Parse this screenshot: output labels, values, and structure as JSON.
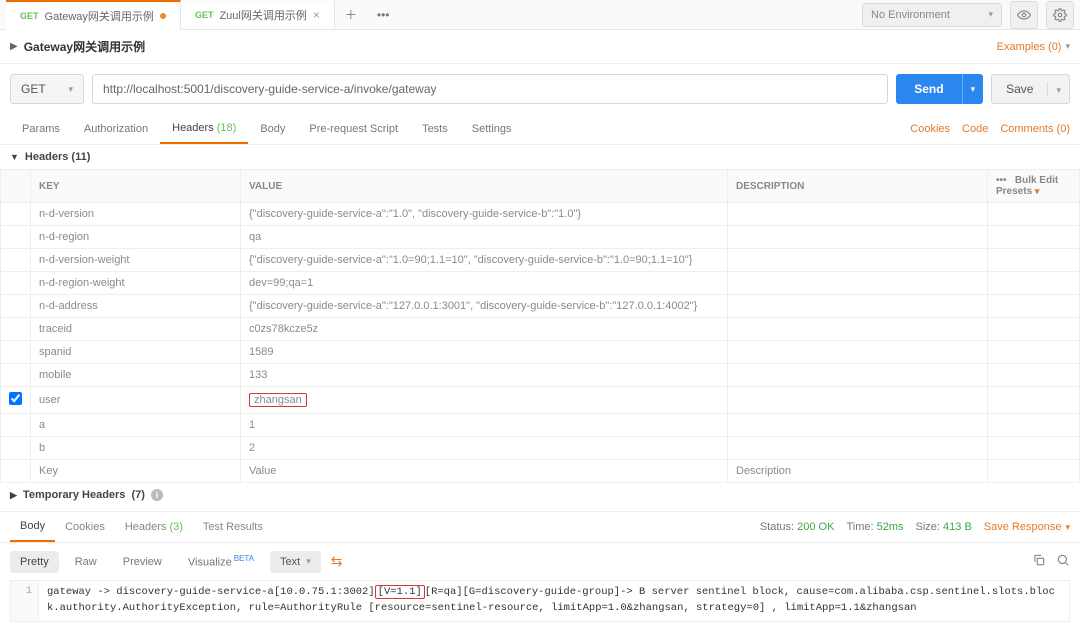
{
  "topbar": {
    "tabs": [
      {
        "method": "GET",
        "name": "Gateway网关调用示例",
        "dirty": true
      },
      {
        "method": "GET",
        "name": "Zuul网关调用示例",
        "dirty": false
      }
    ],
    "env_label": "No Environment"
  },
  "titlebar": {
    "title": "Gateway网关调用示例",
    "examples_label": "Examples (0)"
  },
  "request": {
    "method": "GET",
    "url": "http://localhost:5001/discovery-guide-service-a/invoke/gateway",
    "send_label": "Send",
    "save_label": "Save"
  },
  "req_tabs": {
    "items": [
      {
        "label": "Params"
      },
      {
        "label": "Authorization"
      },
      {
        "label": "Headers",
        "count": "(18)"
      },
      {
        "label": "Body"
      },
      {
        "label": "Pre-request Script"
      },
      {
        "label": "Tests"
      },
      {
        "label": "Settings"
      }
    ],
    "active_index": 2,
    "right": {
      "cookies": "Cookies",
      "code": "Code",
      "comments": "Comments (0)"
    }
  },
  "headers_section": {
    "title": "Headers",
    "count": "(11)",
    "columns": {
      "key": "KEY",
      "value": "VALUE",
      "description": "DESCRIPTION",
      "bulk": "Bulk Edit",
      "presets": "Presets"
    },
    "rows": [
      {
        "key": "n-d-version",
        "value": "{\"discovery-guide-service-a\":\"1.0\", \"discovery-guide-service-b\":\"1.0\"}"
      },
      {
        "key": "n-d-region",
        "value": "qa"
      },
      {
        "key": "n-d-version-weight",
        "value": "{\"discovery-guide-service-a\":\"1.0=90;1.1=10\", \"discovery-guide-service-b\":\"1.0=90;1.1=10\"}"
      },
      {
        "key": "n-d-region-weight",
        "value": "dev=99;qa=1"
      },
      {
        "key": "n-d-address",
        "value": "{\"discovery-guide-service-a\":\"127.0.0.1:3001\", \"discovery-guide-service-b\":\"127.0.0.1:4002\"}"
      },
      {
        "key": "traceid",
        "value": "c0zs78kcze5z"
      },
      {
        "key": "spanid",
        "value": "1589"
      },
      {
        "key": "mobile",
        "value": "133"
      },
      {
        "key": "user",
        "value": "zhangsan",
        "checked": true,
        "highlight": true
      },
      {
        "key": "a",
        "value": "1"
      },
      {
        "key": "b",
        "value": "2"
      }
    ],
    "placeholder": {
      "key": "Key",
      "value": "Value",
      "description": "Description"
    },
    "temp_headers": {
      "label": "Temporary Headers",
      "count": "(7)"
    }
  },
  "response": {
    "tabs": [
      {
        "label": "Body"
      },
      {
        "label": "Cookies"
      },
      {
        "label": "Headers",
        "count": "(3)"
      },
      {
        "label": "Test Results"
      }
    ],
    "active_index": 0,
    "status_label": "Status:",
    "status_value": "200 OK",
    "time_label": "Time:",
    "time_value": "52ms",
    "size_label": "Size:",
    "size_value": "413 B",
    "save_label": "Save Response",
    "views": {
      "pretty": "Pretty",
      "raw": "Raw",
      "preview": "Preview",
      "visualize": "Visualize",
      "beta": "BETA",
      "type": "Text"
    },
    "body_text_before": "gateway -> discovery-guide-service-a[10.0.75.1:3002]",
    "body_text_hl": "[V=1.1]",
    "body_text_after": "[R=qa][G=discovery-guide-group]-> B server sentinel block, cause=com.alibaba.csp.sentinel.slots.block.authority.AuthorityException, rule=AuthorityRule [resource=sentinel-resource, limitApp=1.0&zhangsan, strategy=0] , limitApp=1.1&zhangsan"
  }
}
